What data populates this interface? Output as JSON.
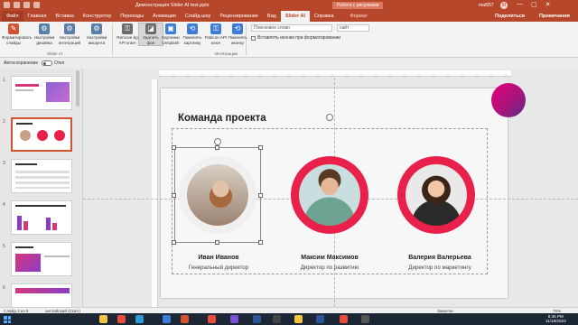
{
  "window": {
    "doc_title": "Демонстрация Slider AI test.pptx",
    "context_tab": "Работа с рисунками",
    "user": "mat557",
    "avatar_letter": "M",
    "controls": [
      "—",
      "▢",
      "✕"
    ]
  },
  "tabs": [
    "Файл",
    "Главная",
    "Вставка",
    "Конструктор",
    "Переходы",
    "Анимация",
    "Слайд-шоу",
    "Рецензирование",
    "Вид",
    "Slider AI",
    "Справка",
    "Формат"
  ],
  "tabs_right": {
    "share": "Поделиться",
    "notes": "Примечания"
  },
  "ribbon": {
    "buttons": [
      {
        "label": "Форматировать слайды",
        "color": "#d35230",
        "icon": "format-slides-icon",
        "glyph": "✎"
      },
      {
        "label": "Настройки дизайна",
        "color": "#5a7fa8",
        "icon": "design-settings-icon",
        "glyph": "⚙"
      },
      {
        "label": "Настройки интеграций",
        "color": "#5a7fa8",
        "icon": "integration-settings-icon",
        "glyph": "⚙"
      },
      {
        "label": "Настройки аккаунта",
        "color": "#5a7fa8",
        "icon": "account-settings-icon",
        "glyph": "⚙"
      },
      {
        "label": "Remove.bg API ключ",
        "color": "#6b6b6b",
        "icon": "key-icon",
        "glyph": "⚿"
      },
      {
        "label": "Удалить фон",
        "color": "#6b6b6b",
        "icon": "remove-background-icon",
        "glyph": "◪"
      },
      {
        "label": "Картинки Unsplash",
        "color": "#3b7dd8",
        "icon": "unsplash-icon",
        "glyph": "▣"
      },
      {
        "label": "Поменять картинку",
        "color": "#3b7dd8",
        "icon": "swap-picture-icon",
        "glyph": "⟲"
      },
      {
        "label": "Flaticon API ключ",
        "color": "#3b7dd8",
        "icon": "flaticon-key-icon",
        "glyph": "⚿"
      },
      {
        "label": "Поменять иконку",
        "color": "#3b7dd8",
        "icon": "swap-icon-icon",
        "glyph": "⟲"
      }
    ],
    "search_placeholder": "Поисковое слово",
    "site_placeholder": "сайт",
    "checkbox_label": "Вставлять иконки при форматировании",
    "group_slider": "Slider AI",
    "group_integrations": "Интеграции"
  },
  "autosave": {
    "label": "Автосохранение",
    "state": "Откл"
  },
  "thumbnails": [
    "1",
    "2",
    "3",
    "4",
    "5",
    "6"
  ],
  "slide": {
    "title": "Команда проекта",
    "people": [
      {
        "name": "Иван Иванов",
        "role": "Генеральный директор",
        "ring": "#f0f0f0",
        "inner": "#c9a184"
      },
      {
        "name": "Максим Максимов",
        "role": "Директор по развитию",
        "ring": "#e8204a",
        "inner": "#8fb2a8"
      },
      {
        "name": "Валерия Валерьева",
        "role": "Директор по маркетингу",
        "ring": "#e8204a",
        "inner": "#6b4a3a"
      }
    ]
  },
  "status": {
    "slide_info": "Слайд 2 из 8",
    "language": "английский (США)",
    "notes": "Заметки",
    "zoom": "75%"
  },
  "taskbar": {
    "time": "6:45 PM",
    "date": "11/16/2023"
  }
}
